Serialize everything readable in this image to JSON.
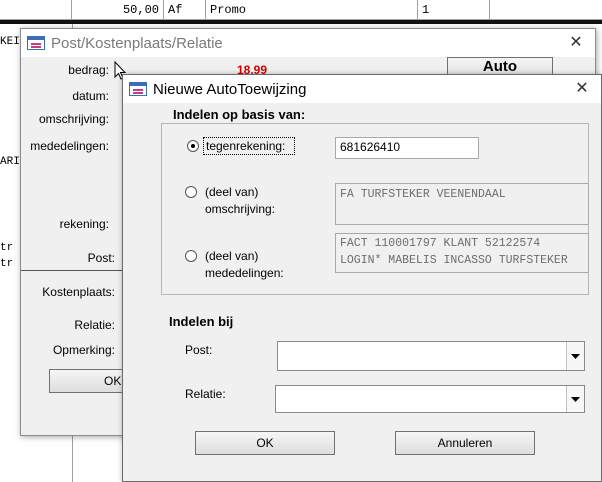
{
  "background": {
    "row": {
      "amount": "50,00",
      "code": "Af",
      "description": "Promo",
      "count": "1"
    },
    "left_fragments": [
      "KEI",
      "ARI",
      "tr",
      "tr"
    ]
  },
  "window1": {
    "title": "Post/Kostenplaats/Relatie",
    "close": "✕",
    "labels": {
      "bedrag": "bedrag:",
      "datum": "datum:",
      "omschrijving": "omschrijving:",
      "mededelingen": "mededelingen:",
      "rekening": "rekening:",
      "post": "Post:",
      "kostenplaats": "Kostenplaats:",
      "relatie": "Relatie:",
      "opmerking": "Opmerking:"
    },
    "amount_value": "18,99",
    "auto_button": "Auto",
    "ok_button": "OK"
  },
  "window2": {
    "title": "Nieuwe AutoToewijzing",
    "close": "✕",
    "group_title": "Indelen op basis van:",
    "options": {
      "tegenrekening": {
        "label": "tegenrekening:",
        "value": "681626410",
        "checked": true
      },
      "omschrijving": {
        "label_line1": "(deel van)",
        "label_line2": "omschrijving:",
        "value": "FA TURFSTEKER VEENENDAAL",
        "checked": false
      },
      "mededelingen": {
        "label_line1": "(deel van)",
        "label_line2": "mededelingen:",
        "value_line1": "FACT 110001797 KLANT 52122574",
        "value_line2": "LOGIN* MABELIS INCASSO TURFSTEKER",
        "checked": false
      }
    },
    "indelen_bij": "Indelen bij",
    "post_label": "Post:",
    "post_value": "",
    "relatie_label": "Relatie:",
    "relatie_value": "",
    "ok_button": "OK",
    "cancel_button": "Annuleren"
  },
  "colors": {
    "amount_red": "#d40000",
    "window_bg": "#f0f0f0",
    "title_icon_blue": "#3a6fb6"
  }
}
